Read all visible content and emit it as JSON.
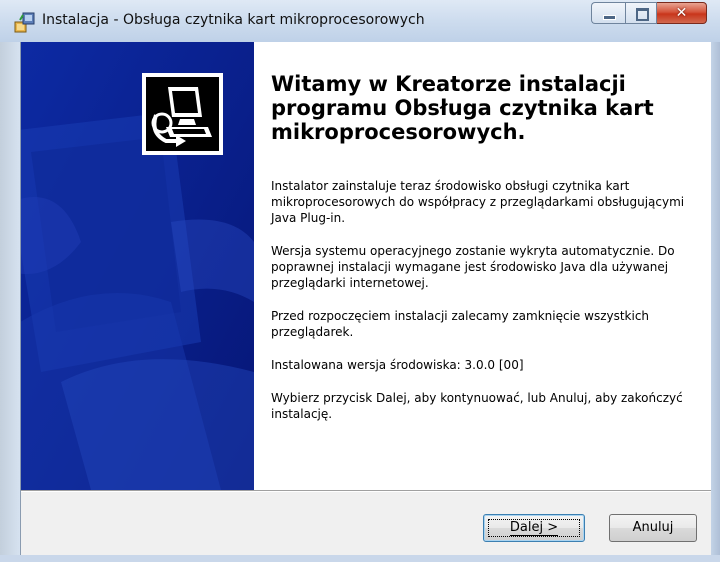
{
  "window": {
    "title": "Instalacja - Obsługa czytnika kart mikroprocesorowych",
    "icon": "installer-icon",
    "caption_buttons": [
      "minimize-icon",
      "maximize-icon",
      "close-icon"
    ]
  },
  "banner": {
    "logo": "computer-setup-icon",
    "background_color": "#0a1f8f"
  },
  "content": {
    "heading": "Witamy w Kreatorze instalacji programu Obsługa czytnika kart mikroprocesorowych.",
    "paragraphs": [
      "Instalator zainstaluje teraz środowisko obsługi czytnika kart mikroprocesorowych do współpracy z przeglądarkami obsługującymi Java Plug-in.",
      "Wersja systemu operacyjnego zostanie wykryta automatycznie. Do poprawnej instalacji wymagane jest środowisko Java dla używanej przeglądarki internetowej.",
      "Przed rozpoczęciem instalacji zalecamy zamknięcie wszystkich przeglądarek.",
      "Instalowana wersja środowiska: 3.0.0 [00]",
      "Wybierz przycisk Dalej, aby kontynuować, lub Anuluj, aby zakończyć instalację."
    ]
  },
  "buttons": {
    "next_label": "Dalej >",
    "cancel_label": "Anuluj"
  },
  "colors": {
    "banner": "#0a1f8f",
    "close_button": "#c8351b",
    "titlebar": "#cddcee"
  }
}
